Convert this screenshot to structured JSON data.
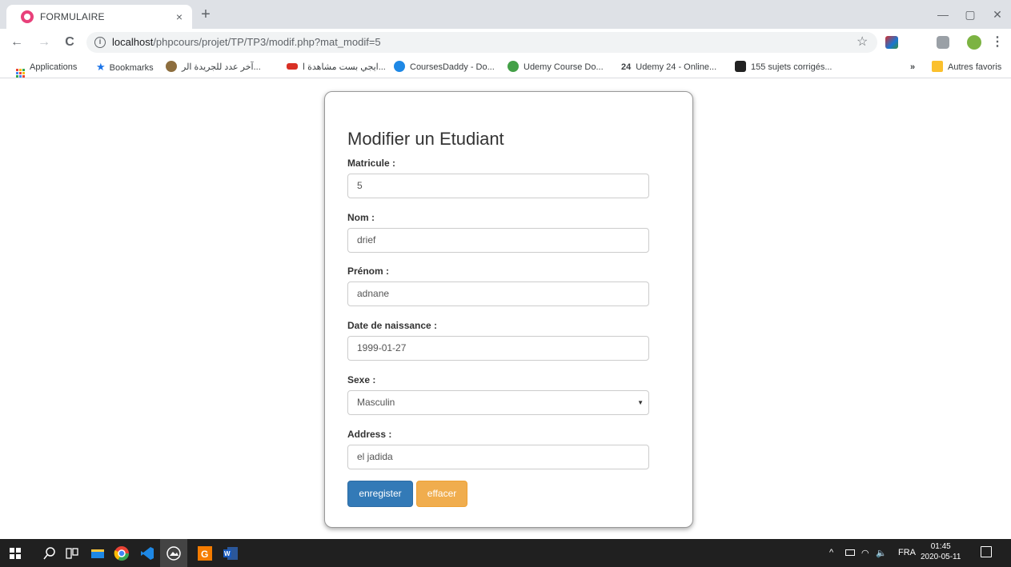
{
  "browser": {
    "tab_title": "FORMULAIRE",
    "tab_close": "×",
    "new_tab": "+",
    "url_host": "localhost",
    "url_path": "/phpcours/projet/TP/TP3/modif.php?mat_modif=5",
    "back": "←",
    "forward": "→",
    "reload": "C",
    "info": "i",
    "star": "☆",
    "menu": "⋮",
    "minimize": "—",
    "restore": "▢",
    "close": "✕"
  },
  "bookmarks": {
    "items": [
      {
        "label": "Applications",
        "icon": "apps-grid-icon",
        "color": "#1a73e8"
      },
      {
        "label": "Bookmarks",
        "icon": "star-icon",
        "color": "#1a73e8"
      },
      {
        "label": "آخر عدد للجريدة الر...",
        "icon": "emblem-icon",
        "color": "#8d6e3e"
      },
      {
        "label": "ايجي بست مشاهدة ا...",
        "icon": "egybest-icon",
        "color": "#d93025"
      },
      {
        "label": "CoursesDaddy - Do...",
        "icon": "coursesdaddy-icon",
        "color": "#1e88e5"
      },
      {
        "label": "Udemy Course Do...",
        "icon": "udemy-icon",
        "color": "#43a047"
      },
      {
        "label": "Udemy 24 - Online...",
        "icon": "udemy24-icon",
        "prefix": "24"
      },
      {
        "label": "155 sujets corrigés...",
        "icon": "sujets-icon",
        "color": "#222"
      }
    ],
    "overflow": "»",
    "other": "Autres favoris"
  },
  "form": {
    "title": "Modifier un Etudiant",
    "matricule_label": "Matricule :",
    "matricule_value": "5",
    "nom_label": "Nom :",
    "nom_value": "drief",
    "prenom_label": "Prénom :",
    "prenom_value": "adnane",
    "date_label": "Date de naissance :",
    "date_value": "1999-01-27",
    "sexe_label": "Sexe :",
    "sexe_value": "Masculin",
    "address_label": "Address :",
    "address_value": "el jadida",
    "submit_label": "enregister",
    "reset_label": "effacer",
    "primary_color": "#337ab7",
    "warning_color": "#f0ad4e"
  },
  "taskbar": {
    "lang": "FRA",
    "time": "01:45",
    "date": "2020-05-11",
    "tray_up": "^",
    "volume": "🔈"
  }
}
